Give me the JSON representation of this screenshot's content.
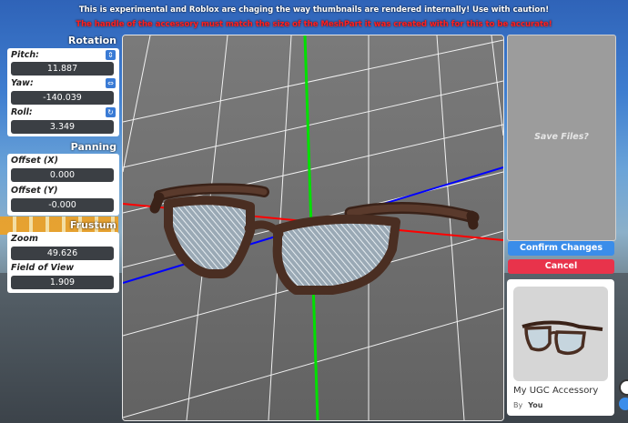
{
  "banner": {
    "warning": "This is experimental and Roblox are chaging the way thumbnails are rendered internally! Use with caution!",
    "handle_note": "The handle of the accessory must match the size of the MeshPart it was created with for this to be accurate!"
  },
  "rotation": {
    "title": "Rotation",
    "pitch": {
      "label": "Pitch:",
      "value": "11.887"
    },
    "yaw": {
      "label": "Yaw:",
      "value": "-140.039"
    },
    "roll": {
      "label": "Roll:",
      "value": "3.349"
    }
  },
  "panning": {
    "title": "Panning",
    "offset_x": {
      "label": "Offset (X)",
      "value": "0.000"
    },
    "offset_y": {
      "label": "Offset (Y)",
      "value": "-0.000"
    }
  },
  "frustum": {
    "title": "Frustum",
    "zoom": {
      "label": "Zoom",
      "value": "49.626"
    },
    "fov": {
      "label": "Field of View",
      "value": "1.909"
    }
  },
  "save_panel": {
    "label": "Save Files?"
  },
  "buttons": {
    "confirm": "Confirm Changes",
    "cancel": "Cancel"
  },
  "accessory_card": {
    "name": "My UGC Accessory",
    "by_label": "By",
    "creator": "You"
  },
  "colors": {
    "accent_blue": "#3a8dea",
    "cancel_red": "#e8334b",
    "axis_x": "#ff0000",
    "axis_y": "#00e000",
    "axis_z": "#0000ff",
    "frame_brown": "#4a2e22"
  },
  "icons": {
    "pitch": "vertical-arrows-icon",
    "yaw": "horizontal-arrows-icon",
    "roll": "rotate-icon"
  }
}
